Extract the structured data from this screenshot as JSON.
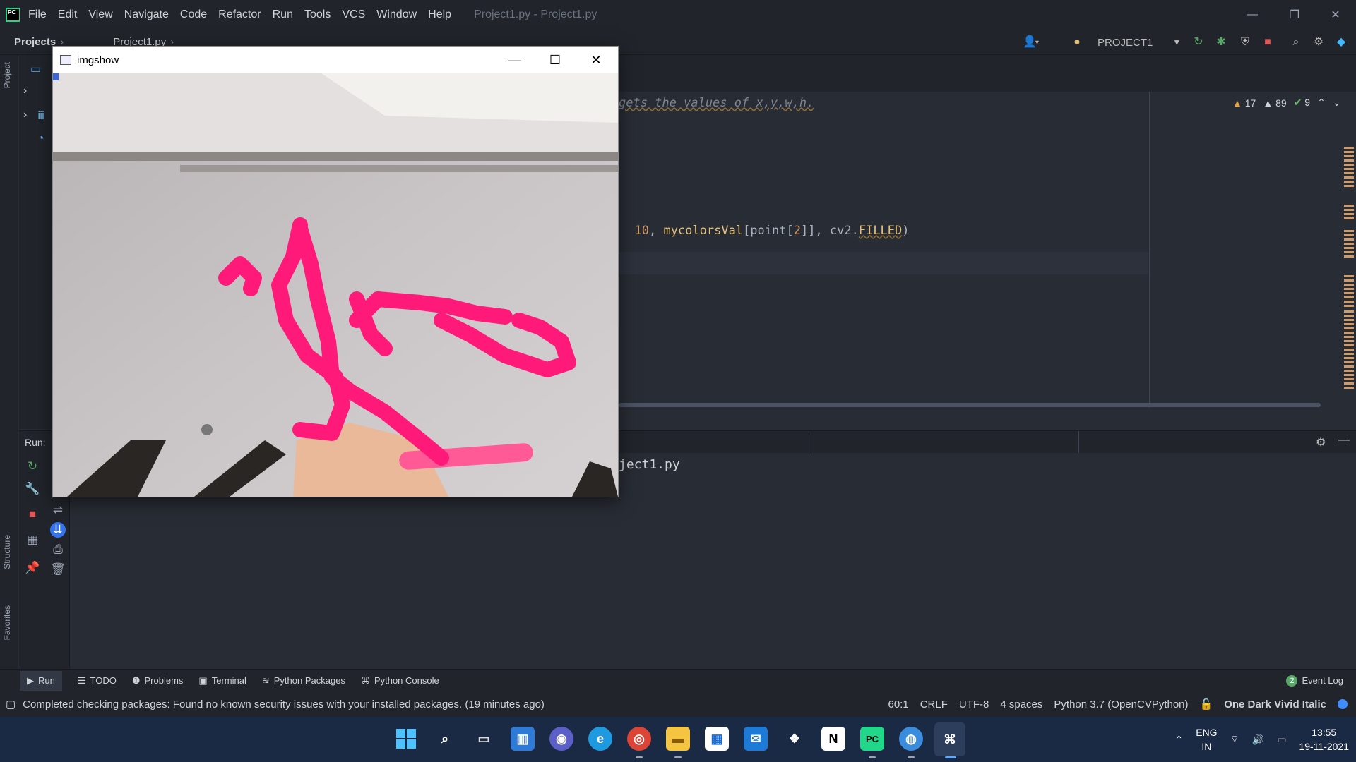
{
  "app": {
    "menu": [
      "File",
      "Edit",
      "View",
      "Navigate",
      "Code",
      "Refactor",
      "Run",
      "Tools",
      "VCS",
      "Window",
      "Help"
    ],
    "window_title": "Project1.py - Project1.py"
  },
  "navbar": {
    "crumb_projects": "Projects",
    "crumb_file": "Project1.py",
    "run_config": "PROJECT1"
  },
  "editor": {
    "line_comment": "gets the values of x,y,w,h.",
    "line_code": {
      "num": "10",
      "sep1": ", ",
      "ident": "mycolorsVal",
      "rest": "[point[",
      "num2": "2",
      "rest2": "]], cv2.",
      "const": "FILLED",
      "close": ")"
    },
    "inspection": {
      "warnings": "17",
      "weak_warnings": "89",
      "ok": "9"
    }
  },
  "run_panel": {
    "label": "Run:",
    "output": "ject1.py"
  },
  "sidebar": {
    "project_tab": "Project",
    "structure_tab": "Structure",
    "favorites_tab": "Favorites"
  },
  "imgshow": {
    "title": "imgshow"
  },
  "bottom_tabs": [
    {
      "label": "Run",
      "icon": "play-icon"
    },
    {
      "label": "TODO",
      "icon": "list-icon"
    },
    {
      "label": "Problems",
      "icon": "info-icon"
    },
    {
      "label": "Terminal",
      "icon": "terminal-icon"
    },
    {
      "label": "Python Packages",
      "icon": "layers-icon"
    },
    {
      "label": "Python Console",
      "icon": "python-icon"
    }
  ],
  "event_log": {
    "count": "2",
    "label": "Event Log"
  },
  "status": {
    "message": "Completed checking packages: Found no known security issues with your installed packages. (19 minutes ago)",
    "position": "60:1",
    "line_sep": "CRLF",
    "encoding": "UTF-8",
    "indent": "4 spaces",
    "interpreter": "Python 3.7 (OpenCVPython)",
    "theme": "One Dark Vivid Italic"
  },
  "tray": {
    "lang_top": "ENG",
    "lang_bottom": "IN",
    "time": "13:55",
    "date": "19-11-2021"
  },
  "colors": {
    "editor_bg": "#282c34",
    "panel_bg": "#21252b",
    "stroke_pink": "#ff1a7a",
    "taskbar_bg": "#1b2a44"
  }
}
